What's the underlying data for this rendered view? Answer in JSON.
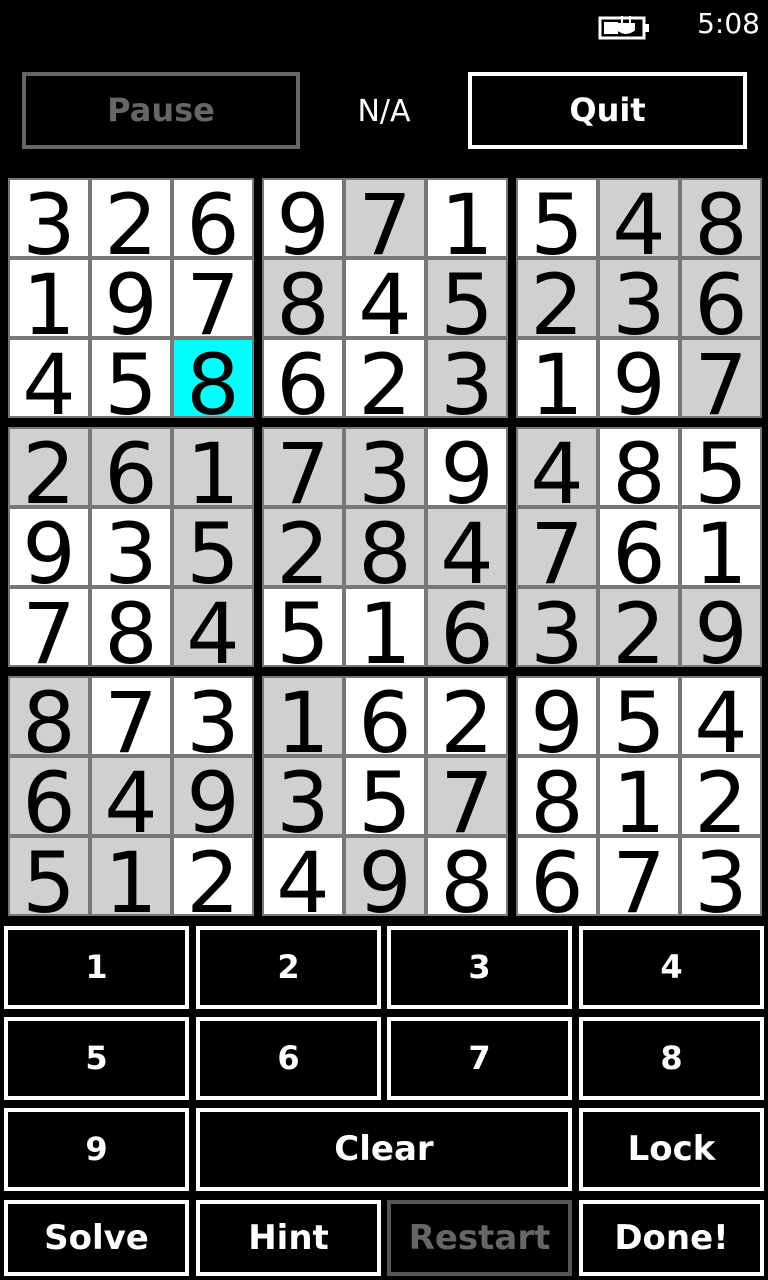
{
  "status_bar": {
    "time": "5:08",
    "battery_icon": "battery-charging-icon"
  },
  "header": {
    "pause_label": "Pause",
    "timer_text": "N/A",
    "quit_label": "Quit"
  },
  "board": {
    "selected_cell": [
      2,
      2
    ],
    "rows": [
      [
        3,
        2,
        6,
        9,
        7,
        1,
        5,
        4,
        8
      ],
      [
        1,
        9,
        7,
        8,
        4,
        5,
        2,
        3,
        6
      ],
      [
        4,
        5,
        8,
        6,
        2,
        3,
        1,
        9,
        7
      ],
      [
        2,
        6,
        1,
        7,
        3,
        9,
        4,
        8,
        5
      ],
      [
        9,
        3,
        5,
        2,
        8,
        4,
        7,
        6,
        1
      ],
      [
        7,
        8,
        4,
        5,
        1,
        6,
        3,
        2,
        9
      ],
      [
        8,
        7,
        3,
        1,
        6,
        2,
        9,
        5,
        4
      ],
      [
        6,
        4,
        9,
        3,
        5,
        7,
        8,
        1,
        2
      ],
      [
        5,
        1,
        2,
        4,
        9,
        8,
        6,
        7,
        3
      ]
    ],
    "shaded": [
      [
        0,
        0,
        0,
        0,
        1,
        0,
        0,
        1,
        1
      ],
      [
        0,
        0,
        0,
        1,
        0,
        1,
        1,
        1,
        1
      ],
      [
        0,
        0,
        0,
        0,
        0,
        1,
        0,
        0,
        1
      ],
      [
        1,
        1,
        1,
        1,
        1,
        0,
        1,
        0,
        0
      ],
      [
        0,
        0,
        1,
        1,
        1,
        1,
        1,
        0,
        0
      ],
      [
        0,
        0,
        1,
        0,
        0,
        1,
        1,
        1,
        1
      ],
      [
        1,
        0,
        0,
        1,
        0,
        0,
        0,
        0,
        0
      ],
      [
        1,
        1,
        1,
        1,
        0,
        1,
        0,
        0,
        0
      ],
      [
        1,
        1,
        0,
        0,
        1,
        0,
        0,
        0,
        0
      ]
    ]
  },
  "keypad": {
    "rows": [
      [
        {
          "label": "1"
        },
        {
          "label": "2"
        },
        {
          "label": "3"
        },
        {
          "label": "4"
        }
      ],
      [
        {
          "label": "5"
        },
        {
          "label": "6"
        },
        {
          "label": "7"
        },
        {
          "label": "8"
        }
      ],
      [
        {
          "label": "9"
        },
        {
          "label": "Clear"
        },
        {
          "label": "Lock"
        }
      ],
      [
        {
          "label": "Solve"
        },
        {
          "label": "Hint"
        },
        {
          "label": "Restart",
          "disabled": true
        },
        {
          "label": "Done!"
        }
      ]
    ]
  },
  "colors": {
    "background": "#000000",
    "cell_white": "#ffffff",
    "cell_shaded": "#d0d0d0",
    "cell_selected": "#00ffff",
    "border": "#ffffff",
    "disabled": "#666666"
  }
}
